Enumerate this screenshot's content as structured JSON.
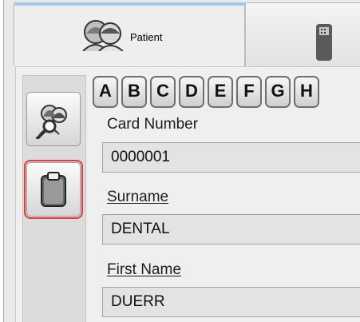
{
  "tabs": {
    "patient_label": "Patient",
    "patient_icon": "patients-icon",
    "other_icon": "device-icon"
  },
  "toolbar": {
    "search_icon": "patient-search-icon",
    "clipboard_icon": "clipboard-icon",
    "highlight_color": "#e53a3a"
  },
  "letters": [
    "A",
    "B",
    "C",
    "D",
    "E",
    "F",
    "G",
    "H"
  ],
  "form": {
    "card_number_label": "Card Number",
    "card_number_value": "0000001",
    "surname_label": "Surname",
    "surname_value": "DENTAL",
    "first_name_label": "First Name",
    "first_name_value": "DUERR"
  }
}
